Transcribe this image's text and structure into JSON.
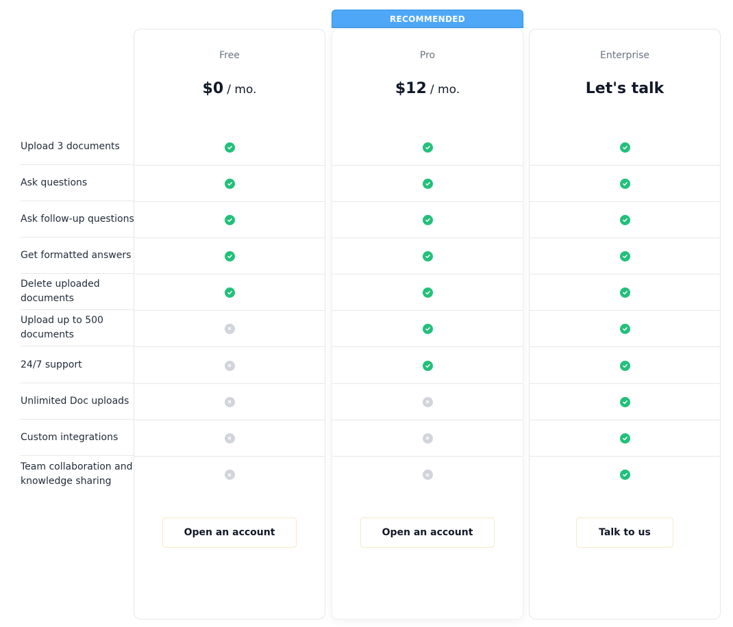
{
  "badge": "RECOMMENDED",
  "features": [
    "Upload 3 documents",
    "Ask questions",
    "Ask follow-up questions",
    "Get formatted answers",
    "Delete uploaded documents",
    "Upload up to 500 documents",
    "24/7 support",
    "Unlimited Doc uploads",
    "Custom integrations",
    "Team collaboration and knowledge sharing"
  ],
  "plans": [
    {
      "name": "Free",
      "price": "$0",
      "unit": "/ mo.",
      "cta": "Open an account",
      "included": [
        true,
        true,
        true,
        true,
        true,
        false,
        false,
        false,
        false,
        false
      ]
    },
    {
      "name": "Pro",
      "price": "$12",
      "unit": "/ mo.",
      "cta": "Open an account",
      "included": [
        true,
        true,
        true,
        true,
        true,
        true,
        true,
        false,
        false,
        false
      ]
    },
    {
      "name": "Enterprise",
      "price_text": "Let's talk",
      "cta": "Talk to us",
      "included": [
        true,
        true,
        true,
        true,
        true,
        true,
        true,
        true,
        true,
        true
      ]
    }
  ],
  "icons": {
    "included": "check-circle-icon",
    "excluded": "x-circle-icon"
  },
  "colors": {
    "accent": "#4ea8f7",
    "check": "#22c07a",
    "cross": "#d1d5db"
  }
}
